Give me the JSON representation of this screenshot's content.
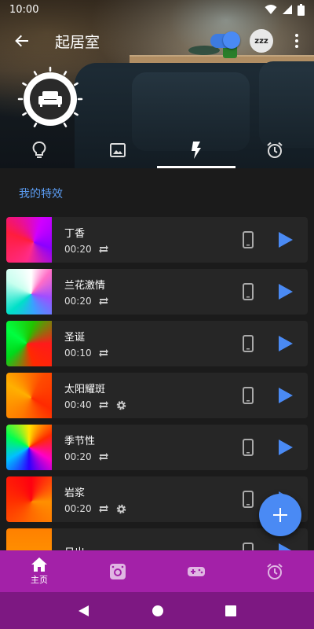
{
  "status_bar": {
    "time": "10:00"
  },
  "app_bar": {
    "title": "起居室",
    "zzz_label": "zzz"
  },
  "tabs": [
    {
      "icon": "bulb-icon"
    },
    {
      "icon": "image-icon"
    },
    {
      "icon": "flash-icon",
      "active": true
    },
    {
      "icon": "alarm-icon"
    }
  ],
  "section": {
    "title": "我的特效"
  },
  "effects": [
    {
      "name": "丁香",
      "duration": "00:20",
      "repeat": true,
      "settings": false
    },
    {
      "name": "兰花激情",
      "duration": "00:20",
      "repeat": true,
      "settings": false
    },
    {
      "name": "圣诞",
      "duration": "00:10",
      "repeat": true,
      "settings": false
    },
    {
      "name": "太阳耀斑",
      "duration": "00:40",
      "repeat": true,
      "settings": true
    },
    {
      "name": "季节性",
      "duration": "00:20",
      "repeat": true,
      "settings": false
    },
    {
      "name": "岩浆",
      "duration": "00:20",
      "repeat": true,
      "settings": true
    },
    {
      "name": "日出",
      "duration": "",
      "repeat": false,
      "settings": false
    }
  ],
  "bottom_nav": {
    "home_label": "主页"
  },
  "colors": {
    "accent": "#4a8af4",
    "nav_bg": "#a321a8",
    "sysnav_bg": "#7d1882"
  }
}
